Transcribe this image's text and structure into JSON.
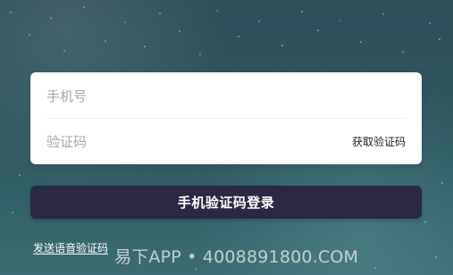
{
  "login": {
    "phone_placeholder": "手机号",
    "code_placeholder": "验证码",
    "get_code_label": "获取验证码",
    "submit_label": "手机验证码登录",
    "voice_code_link": "发送语音验证码"
  },
  "watermark": {
    "text": "易下APP • 4008891800.COM"
  },
  "colors": {
    "background_top": "#2c4f5a",
    "background_bottom": "#3a6d73",
    "card": "#ffffff",
    "button": "#2a2842",
    "placeholder": "#a6a6a6",
    "link": "#ffffff"
  }
}
